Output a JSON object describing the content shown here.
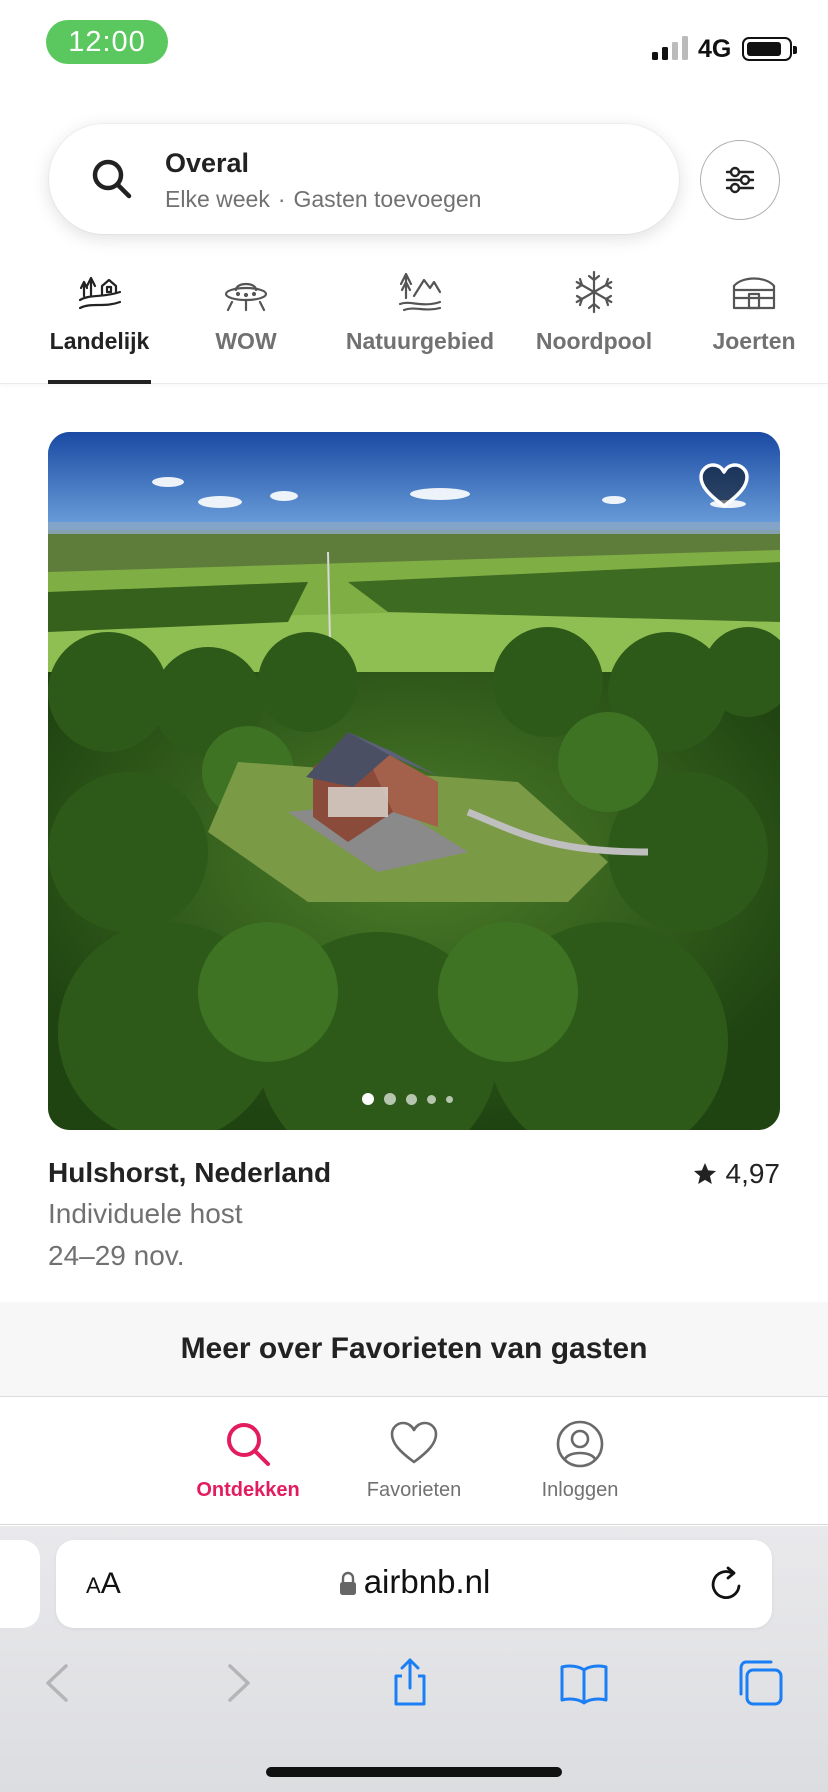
{
  "status_bar": {
    "time": "12:00",
    "network": "4G"
  },
  "search": {
    "title": "Overal",
    "when": "Elke week",
    "separator": "·",
    "guests": "Gasten toevoegen"
  },
  "categories": [
    {
      "label": "Landelijk",
      "icon": "countryside-icon",
      "active": true
    },
    {
      "label": "WOW",
      "icon": "ufo-icon",
      "active": false
    },
    {
      "label": "Natuurgebied",
      "icon": "nature-reserve-icon",
      "active": false
    },
    {
      "label": "Noordpool",
      "icon": "snowflake-icon",
      "active": false
    },
    {
      "label": "Joerten",
      "icon": "yurt-icon",
      "active": false
    }
  ],
  "listing": {
    "location": "Hulshorst, Nederland",
    "rating": "4,97",
    "host": "Individuele host",
    "dates": "24–29 nov.",
    "image_count_dots": 5,
    "active_dot": 0
  },
  "guest_favorites_banner": "Meer over Favorieten van gasten",
  "bottom_nav": [
    {
      "label": "Ontdekken",
      "icon": "search-icon",
      "active": true
    },
    {
      "label": "Favorieten",
      "icon": "heart-icon",
      "active": false
    },
    {
      "label": "Inloggen",
      "icon": "profile-icon",
      "active": false
    }
  ],
  "browser": {
    "text_size_label": "AA",
    "url": "airbnb.nl"
  },
  "colors": {
    "accent": "#e31c5f",
    "text": "#222222",
    "muted": "#717171",
    "status_green": "#5ac85e",
    "safari_blue": "#1a7ef5"
  }
}
